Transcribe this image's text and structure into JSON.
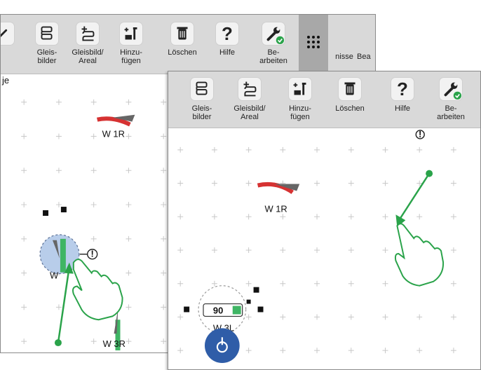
{
  "back_window": {
    "toolbar": {
      "gleisbilder": "Gleis-\nbilder",
      "gleisbild_areal": "Gleisbild/\nAreal",
      "hinzufuegen": "Hinzu-\nfügen",
      "loeschen": "Löschen",
      "hilfe": "Hilfe",
      "bearbeiten": "Be-\narbeiten",
      "ergebnisse": "nisse",
      "bea": "Bea"
    },
    "side_label": "je",
    "labels": {
      "w1r": "W 1R",
      "w3r": "W 3R",
      "w_partial": "W"
    }
  },
  "front_window": {
    "toolbar": {
      "gleisbilder": "Gleis-\nbilder",
      "gleisbild_areal": "Gleisbild/\nAreal",
      "hinzufuegen": "Hinzu-\nfügen",
      "loeschen": "Löschen",
      "hilfe": "Hilfe",
      "bearbeiten": "Be-\narbeiten"
    },
    "labels": {
      "w1r": "W 1R",
      "speed": "90",
      "w_partial": "W 3L"
    }
  },
  "colors": {
    "accent_green": "#2aa34a",
    "track_red": "#d63232",
    "track_green": "#3fb564",
    "selection_blue": "#2f5da8",
    "toolbar_bg": "#d9d9d9"
  }
}
